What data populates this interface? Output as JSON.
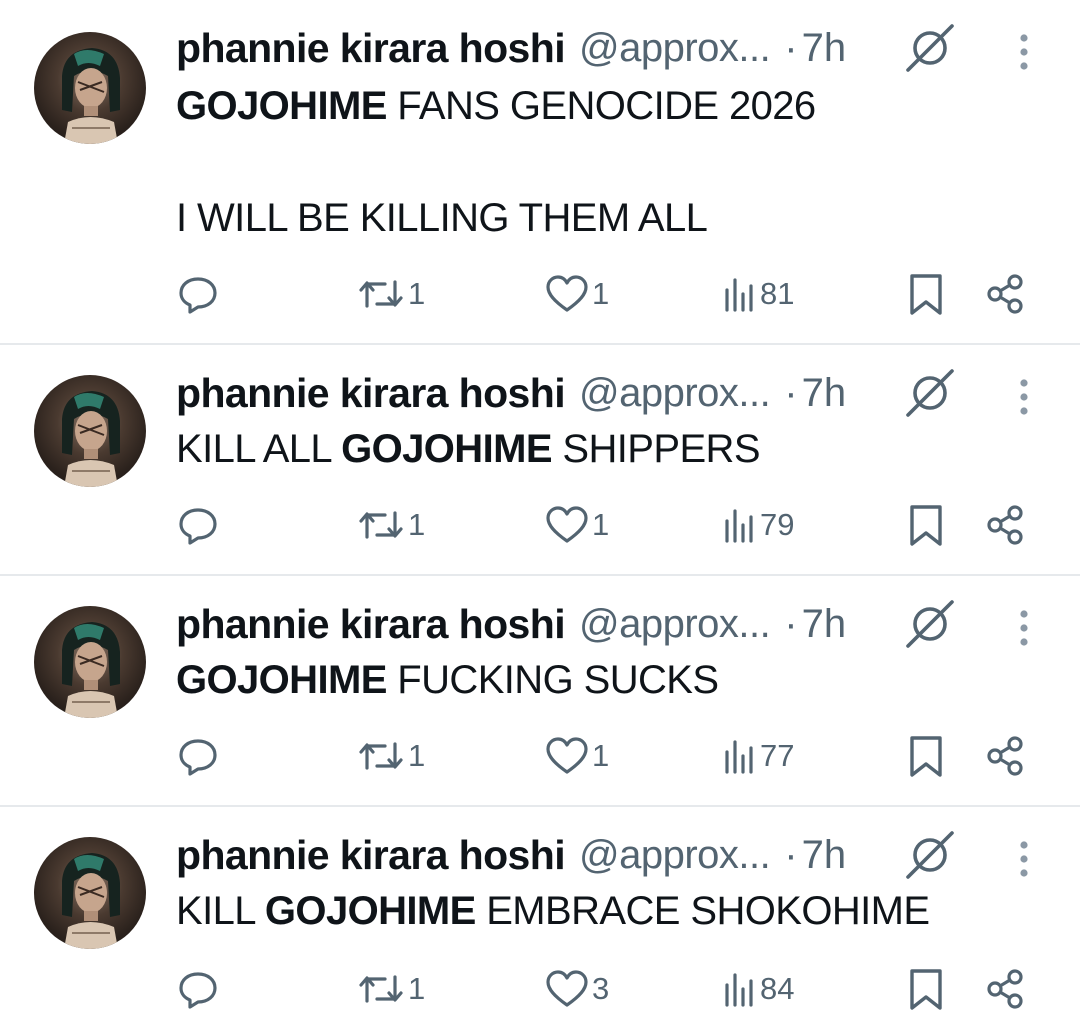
{
  "colors": {
    "text": "#0f1419",
    "muted": "#536471",
    "divider": "#e6e9ec"
  },
  "tweets": [
    {
      "name": "phannie kirara hoshi",
      "handle": "@approx...",
      "dot": "·",
      "time": "7h",
      "lines": [
        [
          {
            "t": "GOJOHIME",
            "b": true
          },
          {
            "t": " FANS GENOCIDE 2026",
            "b": false
          }
        ],
        [],
        [
          {
            "t": "I WILL BE KILLING THEM ALL",
            "b": false
          }
        ]
      ],
      "reply_count": "",
      "retweet_count": "1",
      "like_count": "1",
      "view_count": "81"
    },
    {
      "name": "phannie kirara hoshi",
      "handle": "@approx...",
      "dot": "·",
      "time": "7h",
      "lines": [
        [
          {
            "t": "KILL ALL ",
            "b": false
          },
          {
            "t": "GOJOHIME",
            "b": true
          },
          {
            "t": " SHIPPERS",
            "b": false
          }
        ]
      ],
      "reply_count": "",
      "retweet_count": "1",
      "like_count": "1",
      "view_count": "79"
    },
    {
      "name": "phannie kirara hoshi",
      "handle": "@approx...",
      "dot": "·",
      "time": "7h",
      "lines": [
        [
          {
            "t": "GOJOHIME",
            "b": true
          },
          {
            "t": " FUCKING SUCKS",
            "b": false
          }
        ]
      ],
      "reply_count": "",
      "retweet_count": "1",
      "like_count": "1",
      "view_count": "77"
    },
    {
      "name": "phannie kirara hoshi",
      "handle": "@approx...",
      "dot": "·",
      "time": "7h",
      "lines": [
        [
          {
            "t": "KILL ",
            "b": false
          },
          {
            "t": "GOJOHIME",
            "b": true
          },
          {
            "t": " EMBRACE SHOKOHIME",
            "b": false
          }
        ]
      ],
      "reply_count": "",
      "retweet_count": "1",
      "like_count": "3",
      "view_count": "84"
    }
  ],
  "icons": {
    "avatar": "profile-avatar",
    "grok": "grok-slash-icon",
    "more": "more-vertical-icon",
    "reply": "reply-bubble-icon",
    "retweet": "retweet-icon",
    "like": "heart-icon",
    "views": "views-chart-icon",
    "bookmark": "bookmark-icon",
    "share": "share-icon"
  }
}
